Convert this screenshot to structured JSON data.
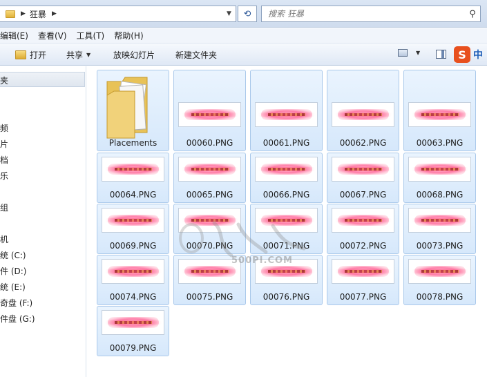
{
  "address": {
    "crumb": "狂暴",
    "search_placeholder": "搜索 狂暴"
  },
  "menu": [
    "编辑(E)",
    "查看(V)",
    "工具(T)",
    "帮助(H)"
  ],
  "commands": {
    "open": "打开",
    "share": "共享",
    "slideshow": "放映幻灯片",
    "new_folder": "新建文件夹"
  },
  "ime": {
    "logo": "S",
    "mode": "中"
  },
  "nav": {
    "items": [
      "夹",
      "频",
      "片",
      "档",
      "乐",
      "组",
      "机",
      "统 (C:)",
      "件 (D:)",
      "统 (E:)",
      "奇盘 (F:)",
      "件盘 (G:)"
    ]
  },
  "files": [
    {
      "name": "Placements",
      "type": "folder"
    },
    {
      "name": "00060.PNG",
      "type": "png"
    },
    {
      "name": "00061.PNG",
      "type": "png"
    },
    {
      "name": "00062.PNG",
      "type": "png"
    },
    {
      "name": "00063.PNG",
      "type": "png"
    },
    {
      "name": "00064.PNG",
      "type": "png"
    },
    {
      "name": "00065.PNG",
      "type": "png"
    },
    {
      "name": "00066.PNG",
      "type": "png"
    },
    {
      "name": "00067.PNG",
      "type": "png"
    },
    {
      "name": "00068.PNG",
      "type": "png"
    },
    {
      "name": "00069.PNG",
      "type": "png"
    },
    {
      "name": "00070.PNG",
      "type": "png"
    },
    {
      "name": "00071.PNG",
      "type": "png"
    },
    {
      "name": "00072.PNG",
      "type": "png"
    },
    {
      "name": "00073.PNG",
      "type": "png"
    },
    {
      "name": "00074.PNG",
      "type": "png"
    },
    {
      "name": "00075.PNG",
      "type": "png"
    },
    {
      "name": "00076.PNG",
      "type": "png"
    },
    {
      "name": "00077.PNG",
      "type": "png"
    },
    {
      "name": "00078.PNG",
      "type": "png"
    },
    {
      "name": "00079.PNG",
      "type": "png"
    }
  ],
  "watermark": "500PI.COM"
}
